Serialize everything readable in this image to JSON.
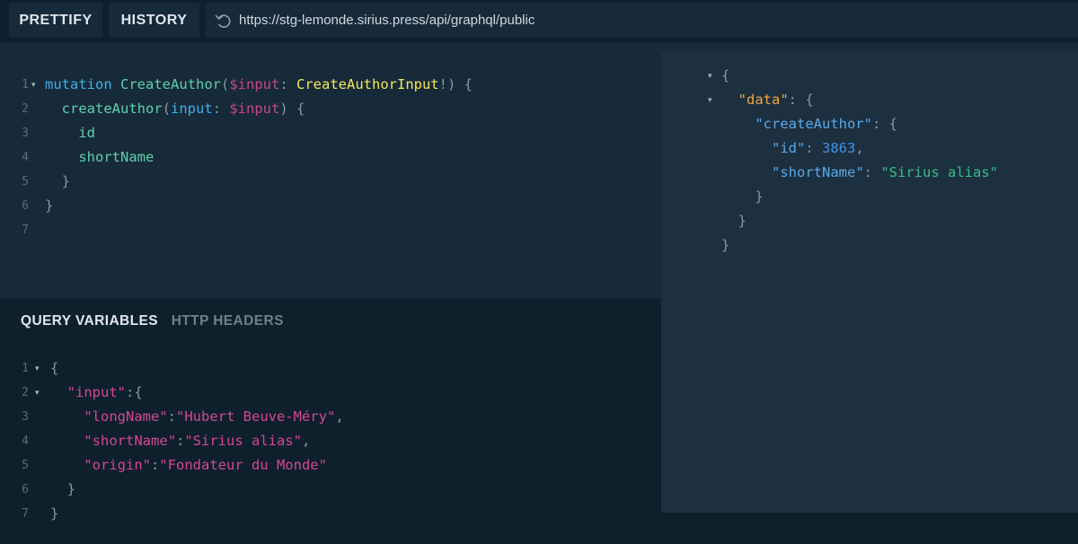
{
  "toolbar": {
    "prettify_label": "PRETTIFY",
    "history_label": "HISTORY",
    "url": "https://stg-lemonde.sirius.press/api/graphql/public"
  },
  "colors": {
    "keyword": "#3fb0e8",
    "def": "#5fd0ad",
    "variable": "#c7468b",
    "type": "#f5e85a",
    "punct": "#8a98a3",
    "string": "#d5488c",
    "number": "#3f92e6",
    "json_key_data": "#f0a63a",
    "json_key": "#58a9e9",
    "json_string": "#37bd86"
  },
  "query": {
    "line_numbers": [
      "1",
      "2",
      "3",
      "4",
      "5",
      "6",
      "7"
    ],
    "lines": [
      [
        {
          "t": "mutation",
          "c": "keyword"
        },
        {
          "t": " ",
          "c": "punct"
        },
        {
          "t": "CreateAuthor",
          "c": "def"
        },
        {
          "t": "(",
          "c": "punct"
        },
        {
          "t": "$input",
          "c": "variable"
        },
        {
          "t": ": ",
          "c": "punct"
        },
        {
          "t": "CreateAuthorInput",
          "c": "type"
        },
        {
          "t": "!) {",
          "c": "punct"
        }
      ],
      [
        {
          "t": "  ",
          "c": "punct"
        },
        {
          "t": "createAuthor",
          "c": "def"
        },
        {
          "t": "(",
          "c": "punct"
        },
        {
          "t": "input",
          "c": "keyword"
        },
        {
          "t": ": ",
          "c": "punct"
        },
        {
          "t": "$input",
          "c": "variable"
        },
        {
          "t": ") {",
          "c": "punct"
        }
      ],
      [
        {
          "t": "    ",
          "c": "punct"
        },
        {
          "t": "id",
          "c": "def"
        }
      ],
      [
        {
          "t": "    ",
          "c": "punct"
        },
        {
          "t": "shortName",
          "c": "def"
        }
      ],
      [
        {
          "t": "  }",
          "c": "punct"
        }
      ],
      [
        {
          "t": "}",
          "c": "punct"
        }
      ],
      []
    ]
  },
  "variables_tabs": {
    "query_variables_label": "QUERY VARIABLES",
    "http_headers_label": "HTTP HEADERS"
  },
  "variables": {
    "line_numbers": [
      "1",
      "2",
      "3",
      "4",
      "5",
      "6",
      "7"
    ],
    "lines": [
      [
        {
          "t": "{",
          "c": "punct"
        }
      ],
      [
        {
          "t": "  ",
          "c": "punct"
        },
        {
          "t": "\"input\"",
          "c": "string"
        },
        {
          "t": ":{",
          "c": "punct"
        }
      ],
      [
        {
          "t": "    ",
          "c": "punct"
        },
        {
          "t": "\"longName\"",
          "c": "string"
        },
        {
          "t": ":",
          "c": "punct"
        },
        {
          "t": "\"Hubert Beuve-Méry\"",
          "c": "string"
        },
        {
          "t": ",",
          "c": "punct"
        }
      ],
      [
        {
          "t": "    ",
          "c": "punct"
        },
        {
          "t": "\"shortName\"",
          "c": "string"
        },
        {
          "t": ":",
          "c": "punct"
        },
        {
          "t": "\"Sirius alias\"",
          "c": "string"
        },
        {
          "t": ",",
          "c": "punct"
        }
      ],
      [
        {
          "t": "    ",
          "c": "punct"
        },
        {
          "t": "\"origin\"",
          "c": "string"
        },
        {
          "t": ":",
          "c": "punct"
        },
        {
          "t": "\"Fondateur du Monde\"",
          "c": "string"
        }
      ],
      [
        {
          "t": "  }",
          "c": "punct"
        }
      ],
      [
        {
          "t": "}",
          "c": "punct"
        }
      ]
    ]
  },
  "result": {
    "lines": [
      [
        {
          "t": "{",
          "c": "punct"
        }
      ],
      [
        {
          "t": "  ",
          "c": "punct"
        },
        {
          "t": "\"data\"",
          "c": "json_key_data"
        },
        {
          "t": ": {",
          "c": "punct"
        }
      ],
      [
        {
          "t": "    ",
          "c": "punct"
        },
        {
          "t": "\"createAuthor\"",
          "c": "json_key"
        },
        {
          "t": ": {",
          "c": "punct"
        }
      ],
      [
        {
          "t": "      ",
          "c": "punct"
        },
        {
          "t": "\"id\"",
          "c": "json_key"
        },
        {
          "t": ": ",
          "c": "punct"
        },
        {
          "t": "3863",
          "c": "number"
        },
        {
          "t": ",",
          "c": "punct"
        }
      ],
      [
        {
          "t": "      ",
          "c": "punct"
        },
        {
          "t": "\"shortName\"",
          "c": "json_key"
        },
        {
          "t": ": ",
          "c": "punct"
        },
        {
          "t": "\"Sirius alias\"",
          "c": "json_string"
        }
      ],
      [
        {
          "t": "    }",
          "c": "punct"
        }
      ],
      [
        {
          "t": "  }",
          "c": "punct"
        }
      ],
      [
        {
          "t": "}",
          "c": "punct"
        }
      ]
    ]
  }
}
